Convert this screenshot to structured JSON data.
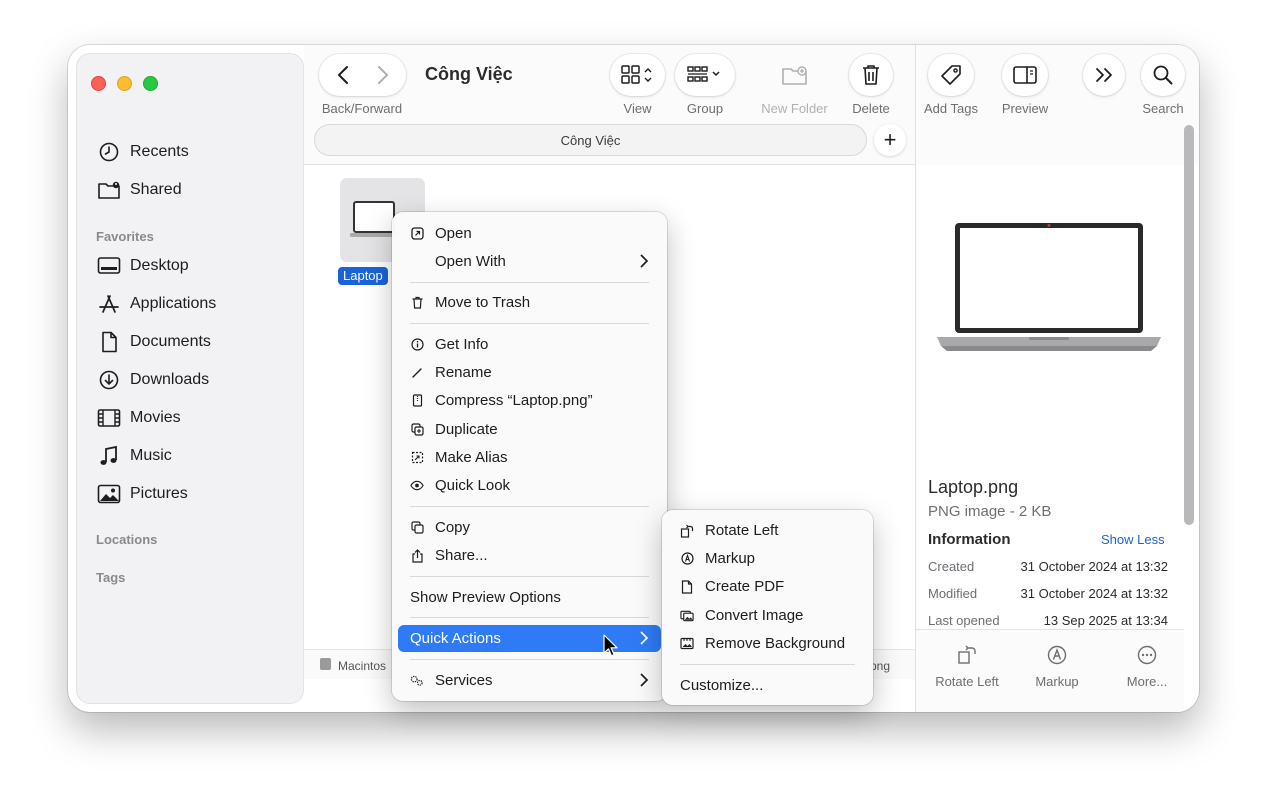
{
  "window": {
    "title": "Công Việc",
    "path": "Công Việc"
  },
  "toolbar": {
    "back_forward": "Back/Forward",
    "view": "View",
    "group": "Group",
    "new_folder": "New Folder",
    "delete": "Delete",
    "add_tags": "Add Tags",
    "preview": "Preview",
    "search": "Search"
  },
  "sidebar": {
    "top_items": [
      {
        "label": "Recents",
        "icon": "clock-icon"
      },
      {
        "label": "Shared",
        "icon": "shared-folder-icon"
      }
    ],
    "favorites_header": "Favorites",
    "favorites": [
      {
        "label": "Desktop",
        "icon": "desktop-icon"
      },
      {
        "label": "Applications",
        "icon": "applications-icon"
      },
      {
        "label": "Documents",
        "icon": "document-icon"
      },
      {
        "label": "Downloads",
        "icon": "download-icon"
      },
      {
        "label": "Movies",
        "icon": "film-icon"
      },
      {
        "label": "Music",
        "icon": "music-icon"
      },
      {
        "label": "Pictures",
        "icon": "photo-icon"
      }
    ],
    "locations_header": "Locations",
    "tags_header": "Tags"
  },
  "file": {
    "label": "Laptop",
    "status_left": "Macintos",
    "status_right": "png"
  },
  "context_menu": {
    "open": "Open",
    "open_with": "Open With",
    "move_to_trash": "Move to Trash",
    "get_info": "Get Info",
    "rename": "Rename",
    "compress": "Compress “Laptop.png”",
    "duplicate": "Duplicate",
    "make_alias": "Make Alias",
    "quick_look": "Quick Look",
    "copy": "Copy",
    "share": "Share...",
    "show_preview_options": "Show Preview Options",
    "quick_actions": "Quick Actions",
    "services": "Services"
  },
  "quick_actions_menu": {
    "rotate_left": "Rotate Left",
    "markup": "Markup",
    "create_pdf": "Create PDF",
    "convert_image": "Convert Image",
    "remove_background": "Remove Background",
    "customize": "Customize..."
  },
  "preview": {
    "name": "Laptop.png",
    "kind": "PNG image - 2 KB",
    "info_header": "Information",
    "show_less": "Show Less",
    "rows": [
      {
        "key": "Created",
        "value": "31 October 2024 at 13:32"
      },
      {
        "key": "Modified",
        "value": "31 October 2024 at 13:32"
      },
      {
        "key": "Last opened",
        "value": "13 Sep 2025 at 13:34"
      }
    ],
    "actions": {
      "rotate_left": "Rotate Left",
      "markup": "Markup",
      "more": "More..."
    }
  },
  "colors": {
    "accent": "#2f7bf5",
    "selection": "#1a64d8",
    "traffic_red": "#fe5f57",
    "traffic_yellow": "#febc2e",
    "traffic_green": "#28c840"
  }
}
